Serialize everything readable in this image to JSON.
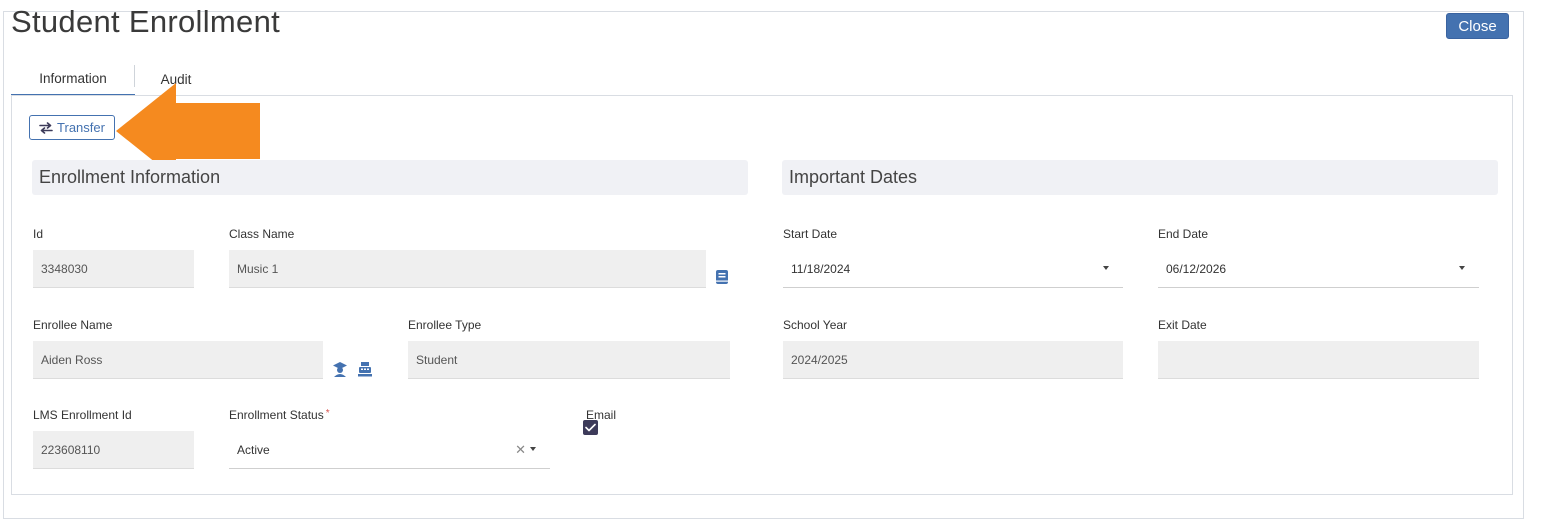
{
  "dialog": {
    "title": "Student Enrollment",
    "close_label": "Close"
  },
  "tabs": [
    {
      "label": "Information",
      "active": true
    },
    {
      "label": "Audit",
      "active": false
    }
  ],
  "toolbar": {
    "transfer_label": "Transfer"
  },
  "sections": {
    "enrollment_info": "Enrollment Information",
    "important_dates": "Important Dates"
  },
  "fields": {
    "id": {
      "label": "Id",
      "value": "3348030"
    },
    "class_name": {
      "label": "Class Name",
      "value": "Music 1"
    },
    "enrollee_name": {
      "label": "Enrollee Name",
      "value": "Aiden Ross"
    },
    "enrollee_type": {
      "label": "Enrollee Type",
      "value": "Student"
    },
    "lms_enrollment_id": {
      "label": "LMS Enrollment Id",
      "value": "223608110"
    },
    "enrollment_status": {
      "label": "Enrollment Status",
      "required_mark": "*",
      "value": "Active"
    },
    "email": {
      "label": "Email",
      "checked": true
    },
    "start_date": {
      "label": "Start Date",
      "value": "11/18/2024"
    },
    "end_date": {
      "label": "End Date",
      "value": "06/12/2026"
    },
    "school_year": {
      "label": "School Year",
      "value": "2024/2025"
    },
    "exit_date": {
      "label": "Exit Date",
      "value": ""
    }
  },
  "icons": {
    "swap": "swap-arrows-icon",
    "book": "book-icon",
    "graduate": "graduate-icon",
    "register": "register-icon",
    "checkmark": "checkmark-icon",
    "clear": "clear-x-icon",
    "caret": "chevron-down-icon"
  },
  "colors": {
    "primary": "#4472b0",
    "annotation_arrow": "#f58a1f",
    "section_bg": "#f0f1f5",
    "readonly_bg": "#efefef",
    "checkbox": "#3d3b5a"
  }
}
